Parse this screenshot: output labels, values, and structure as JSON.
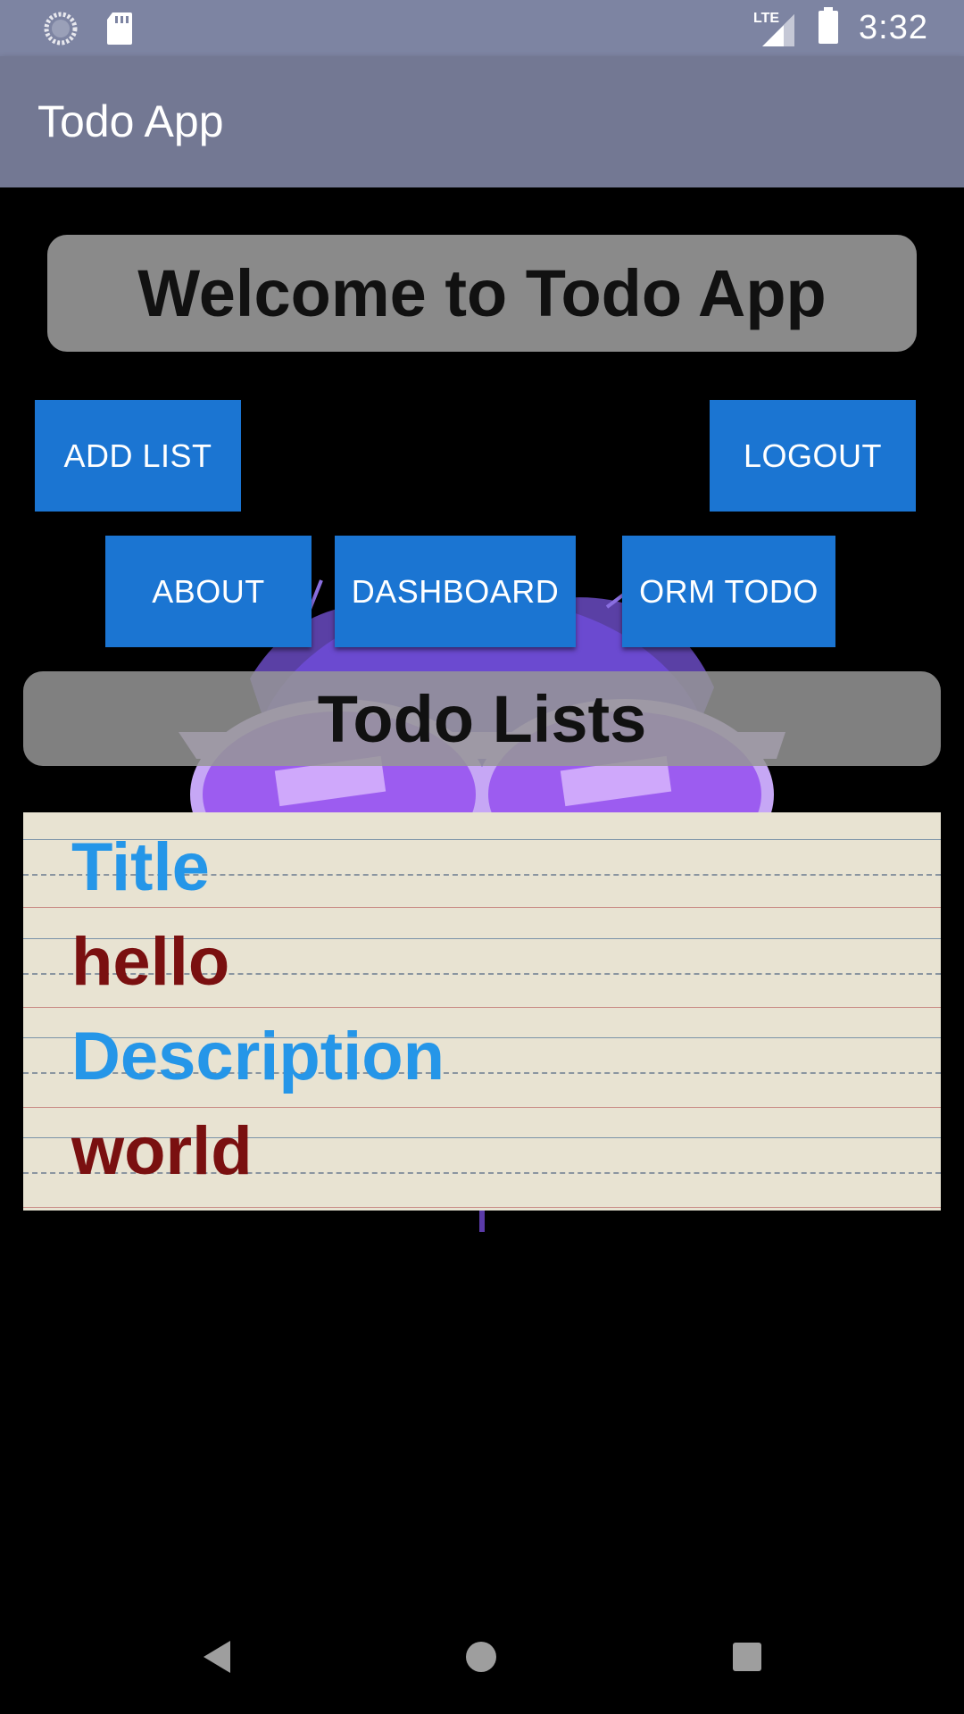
{
  "status_bar": {
    "time": "3:32",
    "network": "LTE",
    "icons": [
      "sync-icon",
      "sd-card-icon",
      "lte-signal-icon",
      "battery-icon"
    ]
  },
  "app_bar": {
    "title": "Todo App"
  },
  "welcome": {
    "text": "Welcome to Todo App"
  },
  "buttons": {
    "add_list": "ADD LIST",
    "logout": "LOGOUT",
    "about": "ABOUT",
    "dashboard": "DASHBOARD",
    "orm_todo": "ORM TODO"
  },
  "lists_header": {
    "text": "Todo Lists"
  },
  "todo_item": {
    "title_label": "Title",
    "title_value": "hello",
    "description_label": "Description",
    "description_value": "world"
  },
  "nav_bar": {
    "icons": [
      "back-icon",
      "home-icon",
      "recents-icon"
    ]
  },
  "colors": {
    "status_bar": "#7d84a2",
    "app_bar": "#737893",
    "button": "#1b75d2",
    "label_blue": "#2596e8",
    "value_red": "#7a1010",
    "paper": "#e8e3d2"
  }
}
